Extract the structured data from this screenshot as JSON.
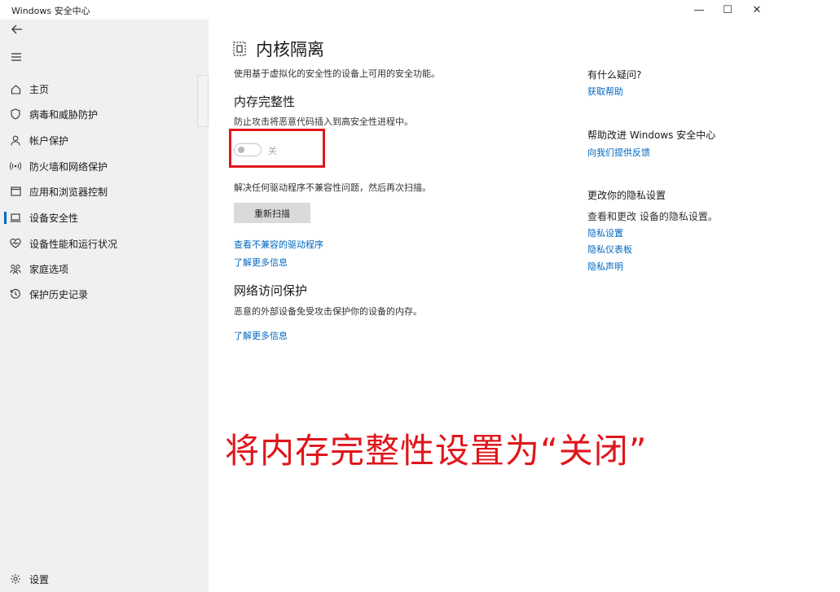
{
  "window": {
    "title": "Windows 安全中心",
    "controls": {
      "minimize": "—",
      "maximize": "☐",
      "close": "✕"
    }
  },
  "sidebar": {
    "back_icon": "back-arrow-icon",
    "menu_icon": "hamburger-icon",
    "items": [
      {
        "label": "主页",
        "icon": "home-icon",
        "active": false
      },
      {
        "label": "病毒和威胁防护",
        "icon": "shield-icon",
        "active": false
      },
      {
        "label": "帐户保护",
        "icon": "person-icon",
        "active": false
      },
      {
        "label": "防火墙和网络保护",
        "icon": "wireless-icon",
        "active": false
      },
      {
        "label": "应用和浏览器控制",
        "icon": "app-window-icon",
        "active": false
      },
      {
        "label": "设备安全性",
        "icon": "laptop-icon",
        "active": true
      },
      {
        "label": "设备性能和运行状况",
        "icon": "heart-icon",
        "active": false
      },
      {
        "label": "家庭选项",
        "icon": "family-icon",
        "active": false
      },
      {
        "label": "保护历史记录",
        "icon": "history-icon",
        "active": false
      }
    ],
    "settings": {
      "label": "设置",
      "icon": "gear-icon"
    }
  },
  "main": {
    "title": "内核隔离",
    "title_icon": "core-isolation-icon",
    "description": "使用基于虚拟化的安全性的设备上可用的安全功能。",
    "memory_integrity": {
      "heading": "内存完整性",
      "description": "防止攻击将恶意代码插入到高安全性进程中。",
      "toggle_state": "关",
      "toggle_on": false
    },
    "driver_note": "解决任何驱动程序不兼容性问题，然后再次扫描。",
    "rescan_label": "重新扫描",
    "link_incompatible": "查看不兼容的驱动程序",
    "link_learn_more_1": "了解更多信息",
    "network_protection": {
      "heading": "网络访问保护",
      "description": "恶意的外部设备免受攻击保护你的设备的内存。",
      "link": "了解更多信息"
    }
  },
  "right_panel": {
    "question_heading": "有什么疑问?",
    "get_help": "获取帮助",
    "improve_heading": "帮助改进 Windows 安全中心",
    "feedback": "向我们提供反馈",
    "privacy_heading": "更改你的隐私设置",
    "privacy_desc": "查看和更改 设备的隐私设置。",
    "privacy_settings": "隐私设置",
    "privacy_dashboard": "隐私仪表板",
    "privacy_statement": "隐私声明"
  },
  "annotation": {
    "text": "将内存完整性设置为“关闭”",
    "color": "#e0161b"
  },
  "colors": {
    "accent": "#0067c0",
    "sidebar_bg": "#f0f0f0",
    "annotation": "#e0161b"
  }
}
